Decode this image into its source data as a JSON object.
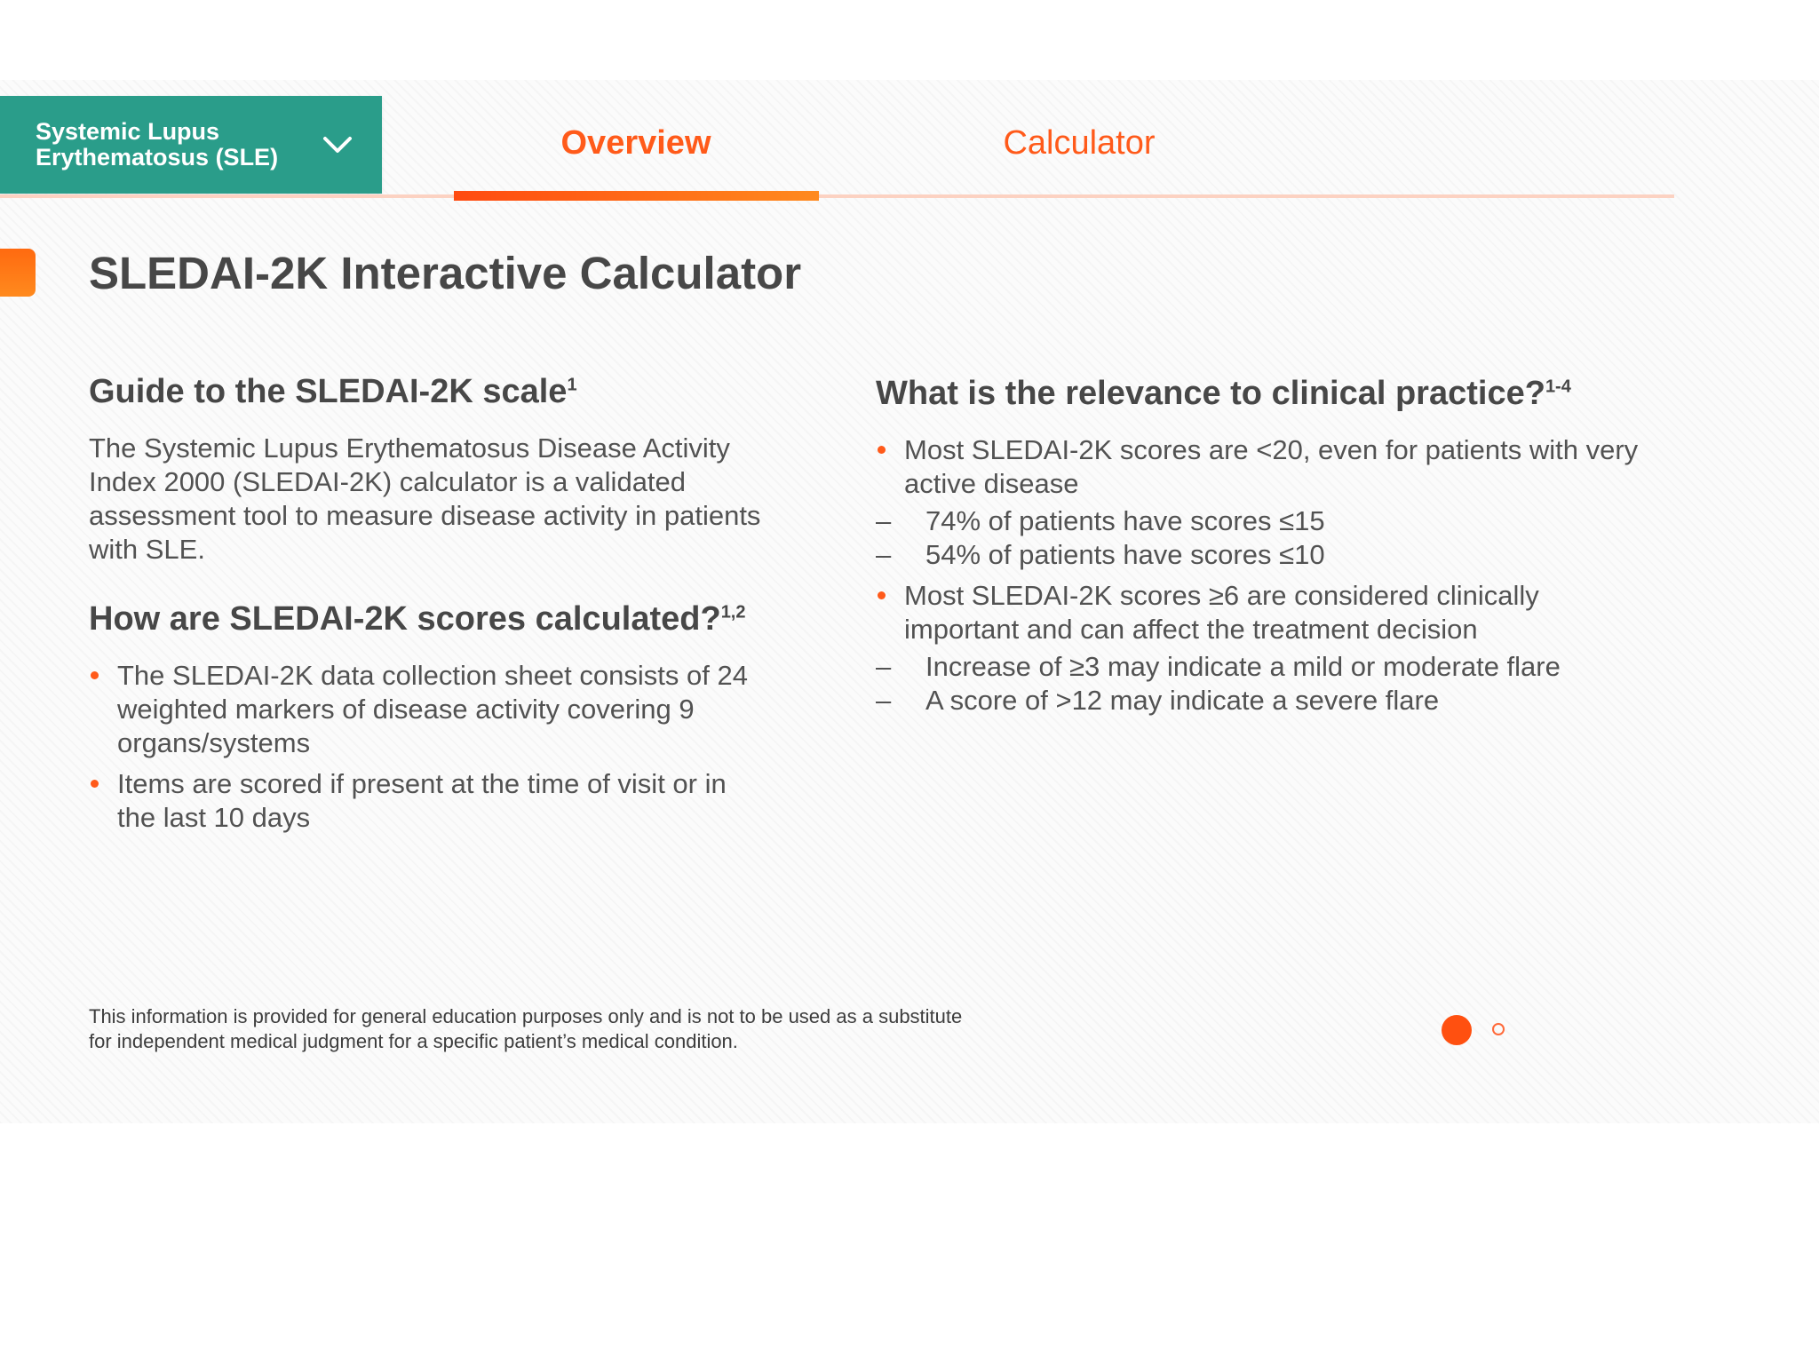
{
  "disease_selector": {
    "label": "Systemic Lupus Erythematosus (SLE)",
    "icon": "chevron-down-icon"
  },
  "tabs": [
    {
      "label": "Overview",
      "active": true
    },
    {
      "label": "Calculator",
      "active": false
    }
  ],
  "colors": {
    "accent": "#ff5a1a",
    "teal": "#2a9d8a",
    "text": "#4a4a4a"
  },
  "page_title": "SLEDAI-2K Interactive Calculator",
  "left": {
    "guide": {
      "heading": "Guide to the SLEDAI-2K scale",
      "ref": "1",
      "text": "The Systemic Lupus Erythematosus Disease Activity Index 2000 (SLEDAI-2K) calculator is a validated assessment tool to measure disease activity in patients with SLE."
    },
    "calc": {
      "heading": "How are SLEDAI-2K scores calculated?",
      "ref": "1,2",
      "bullets": [
        "The SLEDAI-2K data collection sheet consists of 24 weighted markers of disease activity covering 9 organs/systems",
        "Items are scored if present at the time of visit or in the last 10 days"
      ]
    }
  },
  "right": {
    "heading": "What is the relevance to clinical practice?",
    "ref": "1-4",
    "bullets": [
      {
        "text": "Most SLEDAI-2K scores are <20, even for patients with very active disease",
        "sub": [
          "74% of patients have scores ≤15",
          "54% of patients have scores ≤10"
        ]
      },
      {
        "text": "Most SLEDAI-2K scores ≥6 are considered clinically important and can affect the treatment decision",
        "sub": [
          "Increase of ≥3 may indicate a mild or moderate flare",
          "A score of >12 may indicate a severe flare"
        ]
      }
    ]
  },
  "disclaimer": "This information is provided for general education purposes only and is not to be used as a substitute for independent medical judgment for a specific patient’s medical condition.",
  "pager": {
    "current": 1,
    "total": 2
  }
}
